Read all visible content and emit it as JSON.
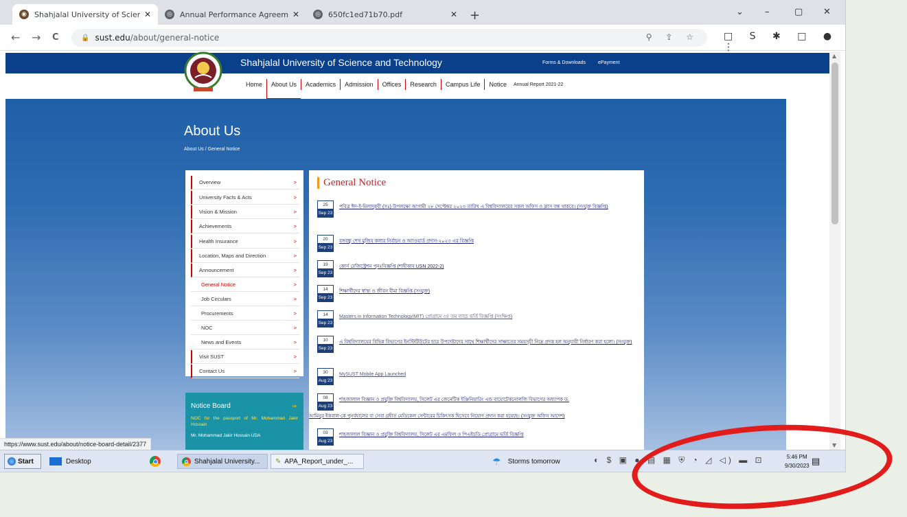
{
  "browser": {
    "tabs": [
      {
        "title": "Shahjalal University of Science & ",
        "active": true
      },
      {
        "title": "Annual Performance Agreement",
        "active": false
      },
      {
        "title": "650fc1ed71b70.pdf",
        "active": false
      }
    ],
    "new_tab": "+",
    "window_controls": [
      "⌄",
      "–",
      "▢",
      "✕"
    ],
    "url_domain": "sust.edu",
    "url_path": "/about/general-notice",
    "nav": {
      "back": "←",
      "forward": "→",
      "reload": "C"
    }
  },
  "site": {
    "name": "Shahjalal University of Science and Technology",
    "top_links": [
      "Forms & Downloads",
      "ePayment"
    ],
    "nav": [
      "Home",
      "About Us",
      "Academics",
      "Admission",
      "Offices",
      "Research",
      "Campus Life",
      "Notice"
    ],
    "nav_extra": "Annual Report 2021-22",
    "page_title": "About Us",
    "breadcrumb": "About Us / General Notice"
  },
  "sidebar": {
    "items": [
      {
        "label": "Overview"
      },
      {
        "label": "University Facts & Acts"
      },
      {
        "label": "Vision & Mission"
      },
      {
        "label": "Achievements"
      },
      {
        "label": "Health Insurance"
      },
      {
        "label": "Location, Maps and Direction"
      },
      {
        "label": "Announcement"
      },
      {
        "label": "General Notice"
      },
      {
        "label": "Job Circulars"
      },
      {
        "label": "Procurements"
      },
      {
        "label": "NOC"
      },
      {
        "label": "News and Events"
      },
      {
        "label": "Visit SUST"
      },
      {
        "label": "Contact Us"
      }
    ],
    "arrow": ">"
  },
  "notice_board": {
    "title": "Notice Board",
    "arrow": "⇒",
    "line1": "NOC for the passport of Mr. Mohammad Jakir Hossain",
    "line2": "Mr. Mohammad Jakir Hossain UDA"
  },
  "content": {
    "title": "General Notice",
    "notices": [
      {
        "day": "25",
        "month": "Sep 23",
        "text": "পবিত্র ঈদ-ই-মিলাদুন্নবী (সঃ) উপলক্ষ্যে আগামী ২৮ সেপ্টেম্বর ২০২৩ তারিখ এ বিশ্ববিদ্যালয়ের সকল অফিস ও ক্লাস বন্ধ থাকবে। (সংযুক্ত বিজ্ঞপ্তি)"
      },
      {
        "day": "20",
        "month": "Sep 23",
        "text": "বঙ্গবন্ধু শেখ মুজিব কলার নির্বাচন ও অ্যাওয়ার্ড প্রদান-২০২৩ এর বিজ্ঞপ্তি"
      },
      {
        "day": "19",
        "month": "Sep 23",
        "text": "কোর্স রেজিস্ট্রেশন পুনঃবিজ্ঞপ্তি (শাহীকাব USN 2022-2)"
      },
      {
        "day": "14",
        "month": "Sep 23",
        "text": "শিক্ষার্থীদের স্বাস্থ্য ও জীবন বীমা বিজ্ঞপ্তি (সংযুক্ত)"
      },
      {
        "day": "14",
        "month": "Sep 23",
        "text": "Masters in Information Technology(MIT) প্রোগ্রামে ৩৪ তম ব্যাচে ভর্তি বিজ্ঞপ্তি (সংক্ষিপ্ত)"
      },
      {
        "day": "10",
        "month": "Sep 23",
        "text": "এ বিশ্ববিদ্যালয়ের বিভিন্ন বিভাগের ইনস্টিটিউটের ছাত্র উপদেষ্টাদের সাথে শিক্ষার্থীদের সাক্ষাতের সময়সূচী নিম্নে প্রদত্ত হল অনুযায়ী নির্ধারণ করা হলো। (সংযুক্ত)"
      },
      {
        "day": "30",
        "month": "Aug 23",
        "text": "MySUST Mobile App Launched"
      },
      {
        "day": "08",
        "month": "Aug 23",
        "text": "শাহজালাল বিজ্ঞান ও প্রযুক্তি বিশ্ববিদ্যালয়, সিলেট এর জেনেটিক ইঞ্জিনিয়ারিং এন্ড বায়োটেকনোলজি বিভাগের অধ্যাপক ড.",
        "text2": "আমিনুর ইকবাল-কে পুনর্বহালের বা সেবা গ্রহীত মেডিকেল সেন্টারের চিকিৎসক হিসেবে নিয়োগ প্রদান করা হয়েছে। (সংযুক্ত অফিস আদেশ)"
      },
      {
        "day": "03",
        "month": "Aug 23",
        "text": "শাহজালাল বিজ্ঞান ও প্রযুক্তি বিশ্ববিদ্যালয়, সিলেট এর এমফিল ও পিএইচডি প্রোগ্রামে ভর্তি বিজ্ঞপ্তি"
      }
    ]
  },
  "status_url": "https://www.sust.edu/about/notice-board-detail/2377",
  "taskbar": {
    "start": "Start",
    "desktop": "Desktop",
    "apps": [
      "Shahjalal University...",
      "APA_Report_under_..."
    ],
    "weather": "Storms tomorrow",
    "time": "5:46 PM",
    "date": "9/30/2023"
  },
  "colors": {
    "brand_blue": "#0a3f8a",
    "accent_red": "#c0262d",
    "annotation_red": "#e21b1b"
  }
}
